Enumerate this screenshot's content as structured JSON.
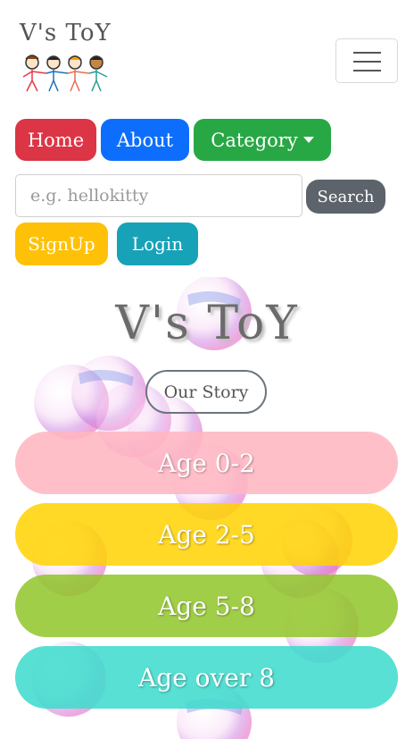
{
  "navbar": {
    "brand": "V's ToY",
    "logo_icon": "kids-holding-hands-icon",
    "toggler_icon": "hamburger-menu-icon"
  },
  "nav": {
    "home": "Home",
    "about": "About",
    "category": "Category"
  },
  "search": {
    "placeholder": "e.g. hellokitty",
    "value": "",
    "button": "Search"
  },
  "auth": {
    "signup": "SignUp",
    "login": "Login"
  },
  "hero": {
    "title": "V's ToY",
    "story_button": "Our Story"
  },
  "ages": [
    {
      "label": "Age 0-2",
      "color": "#ffb6c1"
    },
    {
      "label": "Age 2-5",
      "color": "#ffd200"
    },
    {
      "label": "Age 5-8",
      "color": "#91c528"
    },
    {
      "label": "Age over 8",
      "color": "#40dccd"
    }
  ],
  "colors": {
    "home": "#dc3545",
    "about": "#0d6efd",
    "category": "#28a745",
    "search": "#5c636a",
    "signup": "#ffc107",
    "login": "#17a2b8"
  }
}
